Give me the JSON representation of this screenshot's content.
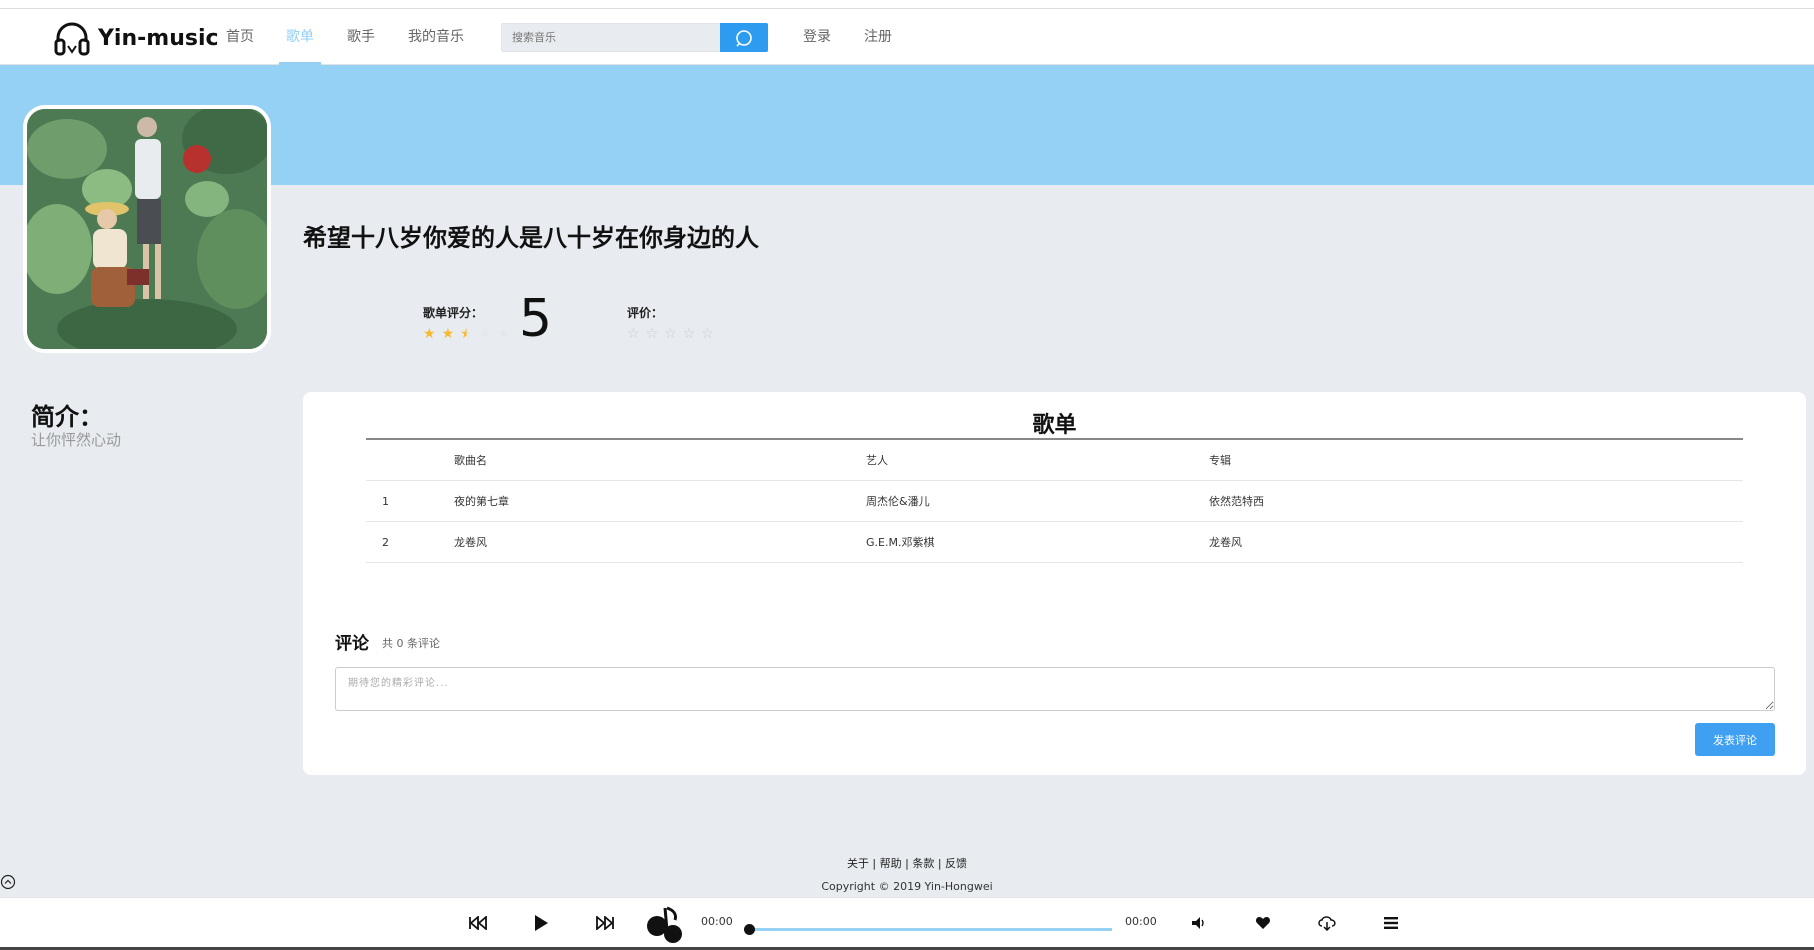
{
  "app": {
    "logo_text": "Yin-music",
    "nav": [
      {
        "label": "首页",
        "active": false
      },
      {
        "label": "歌单",
        "active": true
      },
      {
        "label": "歌手",
        "active": false
      },
      {
        "label": "我的音乐",
        "active": false
      }
    ],
    "search_placeholder": "搜索音乐",
    "login_label": "登录",
    "register_label": "注册"
  },
  "playlist": {
    "title": "希望十八岁你爱的人是八十岁在你身边的人",
    "rating_label": "歌单评分：",
    "rating_value": "5",
    "rating_stars": 2.5,
    "comment_rate_label": "评价：",
    "intro_title": "简介：",
    "intro_text": "让你怦然心动"
  },
  "songlist": {
    "title": "歌单",
    "headers": [
      "",
      "歌曲名",
      "艺人",
      "专辑"
    ],
    "rows": [
      {
        "index": "1",
        "name": "夜的第七章",
        "artist": "周杰伦&潘儿",
        "album": "依然范特西"
      },
      {
        "index": "2",
        "name": "龙卷风",
        "artist": "G.E.M.邓紫棋",
        "album": "龙卷风"
      }
    ]
  },
  "comments": {
    "title": "评论",
    "count_text": "共 0 条评论",
    "placeholder": "期待您的精彩评论...",
    "submit_label": "发表评论"
  },
  "footer": {
    "links": "关于 | 帮助 | 条款 | 反馈",
    "copyright": "Copyright © 2019 Yin-Hongwei"
  },
  "player": {
    "current_time": "00:00",
    "total_time": "00:00",
    "progress": 0
  },
  "colors": {
    "accent": "#95d1f4",
    "search_button": "#2d9bef",
    "submit_button": "#3f9ff1",
    "star": "#f7ba2a"
  }
}
